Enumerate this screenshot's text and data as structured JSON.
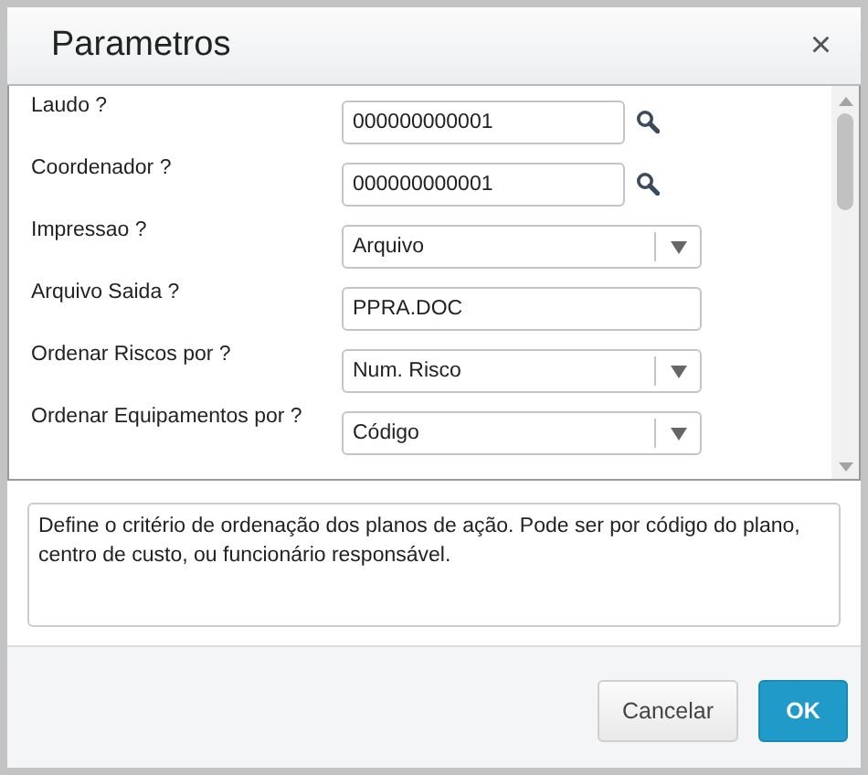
{
  "window": {
    "title": "Parametros",
    "close": "×"
  },
  "fields": [
    {
      "kind": "lookup",
      "label": "Laudo ?",
      "value": "000000000001"
    },
    {
      "kind": "lookup",
      "label": "Coordenador ?",
      "value": "000000000001"
    },
    {
      "kind": "select",
      "label": "Impressao ?",
      "value": "Arquivo"
    },
    {
      "kind": "text",
      "label": "Arquivo Saida ?",
      "value": "PPRA.DOC"
    },
    {
      "kind": "select",
      "label": "Ordenar Riscos por ?",
      "value": "Num. Risco"
    },
    {
      "kind": "select",
      "label": "Ordenar Equipamentos por ?",
      "value": "Código"
    }
  ],
  "help": "Define o critério de ordenação dos planos de ação. Pode ser por código do plano, centro de custo, ou funcionário responsável.",
  "buttons": [
    {
      "label": "Cancelar",
      "kind": "secondary"
    },
    {
      "label": "OK",
      "kind": "primary"
    }
  ]
}
